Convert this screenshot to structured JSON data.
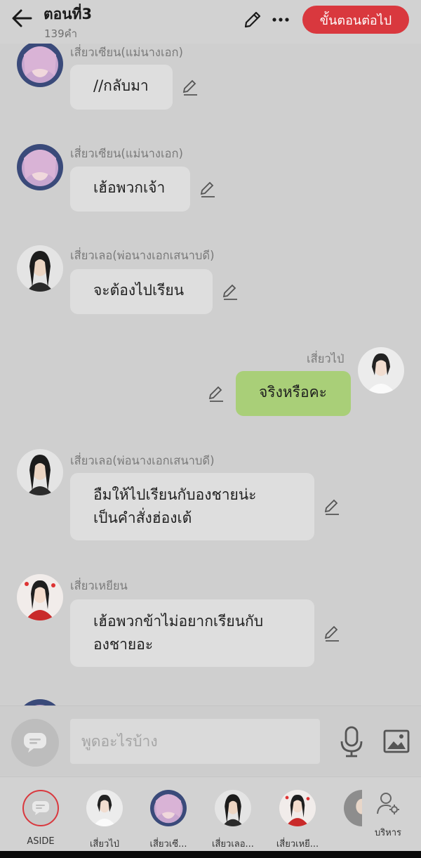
{
  "header": {
    "title": "ตอนที่3",
    "word_count": "139คำ",
    "next_label": "ขั้นตอนต่อไป"
  },
  "messages": [
    {
      "name": "เสี่ยวเซียน(แม่นางเอก)",
      "lines": [
        "//กลับมา"
      ],
      "side": "left",
      "avatar": "pink-hair-avatar"
    },
    {
      "name": "เสี่ยวเซียน(แม่นางเอก)",
      "lines": [
        "เฮ้อพวกเจ้า"
      ],
      "side": "left",
      "avatar": "pink-hair-avatar"
    },
    {
      "name": "เสี่ยวเลอ(พ่อนางเอกเสนาบดี)",
      "lines": [
        "จะต้องไปเรียน"
      ],
      "side": "left",
      "avatar": "dark-hair-man-avatar"
    },
    {
      "name": "เสี่ยวไป่",
      "lines": [
        "จริงหรือคะ"
      ],
      "side": "right",
      "avatar": "white-dress-avatar"
    },
    {
      "name": "เสี่ยวเลอ(พ่อนางเอกเสนาบดี)",
      "lines": [
        "อืมให้ไปเรียนกับองชายน่ะ",
        "เป็นคำสั่งฮ่องเต้"
      ],
      "side": "left",
      "avatar": "dark-hair-man-avatar"
    },
    {
      "name": "เสี่ยวเหยียน",
      "lines": [
        "เฮ้อพวกข้าไม่อยากเรียนกับ",
        "องชายอะ"
      ],
      "side": "left",
      "avatar": "red-robe-avatar"
    }
  ],
  "composer": {
    "placeholder": "พูดอะไรบ้าง"
  },
  "characters": [
    {
      "label": "ASIDE",
      "avatar": "aside-icon"
    },
    {
      "label": "เสี่ยวไป่",
      "avatar": "white-dress-avatar"
    },
    {
      "label": "เสี่ยวเซี...",
      "avatar": "pink-hair-avatar"
    },
    {
      "label": "เสี่ยวเลอ...",
      "avatar": "dark-hair-man-avatar"
    },
    {
      "label": "เสี่ยวเหยี...",
      "avatar": "red-robe-avatar"
    }
  ],
  "manage_label": "บริหาร",
  "colors": {
    "accent": "#d9383e",
    "my_bubble": "#a9cf78",
    "other_bubble": "#dedede",
    "background": "#cfcfcf"
  }
}
